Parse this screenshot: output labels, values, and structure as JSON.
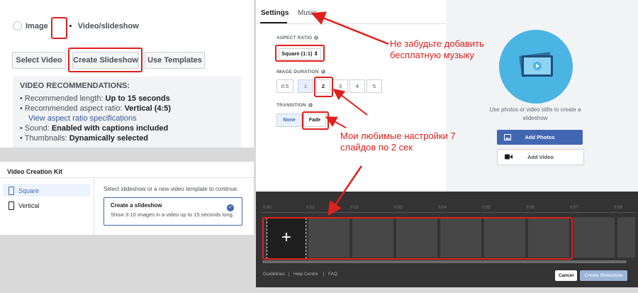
{
  "left_top": {
    "radio_image": "Image",
    "radio_video": "Video/slideshow",
    "btn_select_video": "Select Video",
    "btn_create_slideshow": "Create Slideshow",
    "btn_use_templates": "Use Templates",
    "rec_title": "VIDEO RECOMMENDATIONS:",
    "rec_length_label": "Recommended length: ",
    "rec_length_value": "Up to 15 seconds",
    "rec_ratio_label": "Recommended aspect ratio: ",
    "rec_ratio_value": "Vertical (4:5)",
    "rec_ratio_link": "View aspect ratio specifications",
    "rec_sound_label": "Sound: ",
    "rec_sound_value": "Enabled with captions included",
    "rec_thumbs_label": "Thumbnails: ",
    "rec_thumbs_value": "Dynamically selected",
    "bullet": "•"
  },
  "kit": {
    "title": "Video Creation Kit",
    "side_items": [
      "Square",
      "Vertical"
    ],
    "instruction": "Select slideshow or a new video template to continue.",
    "card_title": "Create a slideshow",
    "card_desc": "Show 3-10 images in a video up to 15 seconds long.",
    "check": "✓"
  },
  "settings": {
    "tabs": [
      "Settings",
      "Music"
    ],
    "aspect_label": "ASPECT RATIO",
    "aspect_value": "Square (1:1) ⇕",
    "duration_label": "IMAGE DURATION",
    "durations": [
      "0.5",
      "1",
      "2",
      "3",
      "4",
      "5"
    ],
    "transition_label": "TRANSITION",
    "transitions": [
      "None",
      "Fade"
    ],
    "info": "i"
  },
  "uploader": {
    "text": "Use photos or video stills to create a slideshow",
    "add_photos": "Add Photos",
    "add_video": "Add Video"
  },
  "timeline": {
    "times": [
      "0:00",
      "0:01",
      "0:02",
      "0:03",
      "0:04",
      "0:05",
      "0:06",
      "0:07",
      "0:08"
    ],
    "add_symbol": "+",
    "footer_links": [
      "Guidelines",
      "Help Centre",
      "FAQ"
    ],
    "separator": "|",
    "cancel": "Cancel",
    "create": "Create Slideshow"
  },
  "annotations": {
    "music_note": "Не забудьте добавить бесплатную музыку",
    "settings_note": "Мои любимые настройки 7 слайдов по 2 сек"
  },
  "colors": {
    "highlight": "#e0201c",
    "brand_blue": "#4267b2",
    "illustration": "#4ab5e3"
  }
}
